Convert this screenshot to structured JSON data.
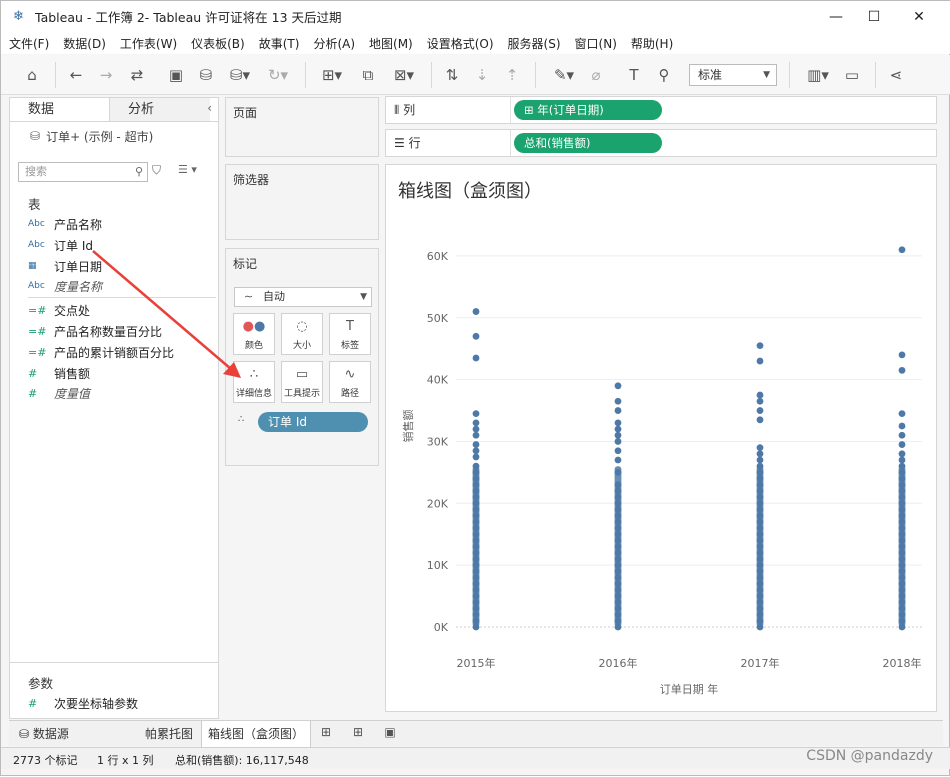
{
  "window": {
    "title": "Tableau - 工作簿 2- Tableau 许可证将在 13 天后过期",
    "controls": [
      "—",
      "☐",
      "✕"
    ]
  },
  "menu": [
    "文件(F)",
    "数据(D)",
    "工作表(W)",
    "仪表板(B)",
    "故事(T)",
    "分析(A)",
    "地图(M)",
    "设置格式(O)",
    "服务器(S)",
    "窗口(N)",
    "帮助(H)"
  ],
  "toolbar": {
    "fit_select": "标准"
  },
  "left_pane": {
    "tabs": [
      "数据",
      "分析"
    ],
    "datasource": "订单+ (示例 - 超市)",
    "search_placeholder": "搜索",
    "tables_header": "表",
    "fields": [
      {
        "type": "Abc",
        "label": "产品名称"
      },
      {
        "type": "Abc",
        "label": "订单 Id"
      },
      {
        "type": "日",
        "label": "订单日期"
      },
      {
        "type": "Abc",
        "label": "度量名称"
      },
      {
        "type": "=#",
        "label": "交点处"
      },
      {
        "type": "=#",
        "label": "产品名称数量百分比"
      },
      {
        "type": "=#",
        "label": "产品的累计销额百分比"
      },
      {
        "type": "#",
        "label": "销售额"
      },
      {
        "type": "#",
        "label": "度量值"
      }
    ],
    "params_header": "参数",
    "params": [
      {
        "type": "#",
        "label": "次要坐标轴参数"
      }
    ]
  },
  "cards": {
    "pages": "页面",
    "filters": "筛选器",
    "marks": "标记",
    "mark_type": "自动",
    "mark_buttons": [
      "颜色",
      "大小",
      "标签",
      "详细信息",
      "工具提示",
      "路径"
    ],
    "detail_pill": "订单 Id"
  },
  "shelves": {
    "columns_label": "列",
    "columns_pill": "年(订单日期)",
    "rows_label": "行",
    "rows_pill": "总和(销售额)"
  },
  "chart_data": {
    "type": "scatter",
    "title": "箱线图（盒须图）",
    "xlabel": "订单日期 年",
    "ylabel": "销售额",
    "categories": [
      "2015年",
      "2016年",
      "2017年",
      "2018年"
    ],
    "y_ticks": [
      "0K",
      "10K",
      "20K",
      "30K",
      "40K",
      "50K",
      "60K"
    ],
    "ylim": [
      0,
      65000
    ],
    "grid": true,
    "series": [
      {
        "values": [
          51000,
          47000,
          43500,
          34500,
          33000,
          32000,
          31000,
          29500,
          28500,
          27500,
          26000,
          25000,
          24000,
          23000,
          22000,
          21000,
          20000,
          19000,
          18000,
          17000,
          16000,
          15000,
          14000,
          13000,
          12000,
          11000,
          10000,
          9000,
          8000,
          7000,
          6000,
          5000,
          4000,
          3000,
          2000,
          1000,
          0
        ]
      },
      {
        "values": [
          39000,
          36500,
          35000,
          33000,
          32000,
          31000,
          30000,
          28500,
          27000,
          25000,
          23000,
          22000,
          21000,
          20000,
          19000,
          18000,
          17000,
          16000,
          15000,
          14000,
          13000,
          12000,
          11000,
          10000,
          9000,
          8000,
          7000,
          6000,
          5000,
          4000,
          3000,
          2000,
          1000,
          0
        ]
      },
      {
        "values": [
          45500,
          43000,
          37500,
          36500,
          35000,
          33500,
          29000,
          28000,
          27000,
          26000,
          25000,
          24000,
          23000,
          22000,
          21000,
          20000,
          19000,
          18000,
          17000,
          16000,
          15000,
          14000,
          13000,
          12000,
          11000,
          10000,
          9000,
          8000,
          7000,
          6000,
          5000,
          4000,
          3000,
          2000,
          1000,
          0
        ]
      },
      {
        "values": [
          61000,
          44000,
          41500,
          34500,
          32500,
          31000,
          29500,
          28000,
          27000,
          26000,
          25000,
          24000,
          23000,
          22000,
          21000,
          20000,
          19000,
          18000,
          17000,
          16000,
          15000,
          14000,
          13000,
          12000,
          11000,
          10000,
          9000,
          8000,
          7000,
          6000,
          5000,
          4000,
          3000,
          2000,
          1000,
          0
        ]
      }
    ]
  },
  "sheets": {
    "datasource_tab": "数据源",
    "tabs": [
      "帕累托图",
      "箱线图（盒须图）"
    ]
  },
  "status": {
    "marks": "2773 个标记",
    "dims": "1 行 x 1 列",
    "sum": "总和(销售额): 16,117,548"
  },
  "watermark": "CSDN @pandazdy",
  "colors": {
    "point": "#4e79a7",
    "pill_green": "#1aa36e",
    "pill_blue": "#4f8fb0",
    "arrow": "#e8413a"
  }
}
